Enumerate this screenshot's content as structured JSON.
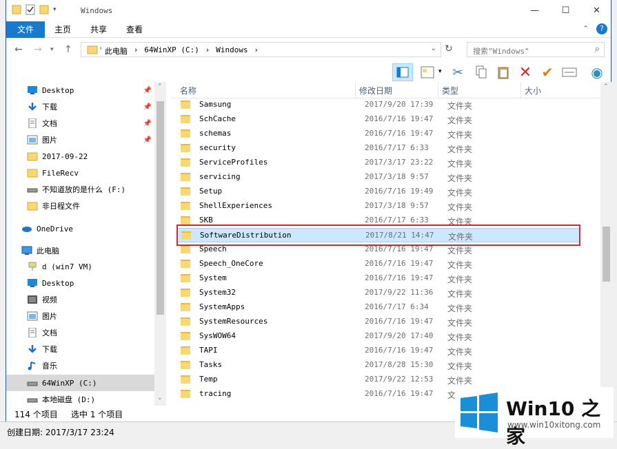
{
  "window": {
    "title": "Windows"
  },
  "ribbon": {
    "tabs": [
      "文件",
      "主页",
      "共享",
      "查看"
    ]
  },
  "address": {
    "crumbs": [
      "此电脑",
      "64WinXP (C:)",
      "Windows"
    ],
    "search_placeholder": "搜索\"Windows\""
  },
  "nav": {
    "items": [
      {
        "label": "Desktop",
        "icon": "desktop-icon",
        "pinned": true
      },
      {
        "label": "下载",
        "icon": "download-icon",
        "pinned": true
      },
      {
        "label": "文档",
        "icon": "document-icon",
        "pinned": true
      },
      {
        "label": "图片",
        "icon": "pictures-icon",
        "pinned": true
      },
      {
        "label": "2017-09-22",
        "icon": "folder-icon"
      },
      {
        "label": "FileRecv",
        "icon": "folder-icon"
      },
      {
        "label": "不知道放的是什么 (F:)",
        "icon": "drive-icon"
      },
      {
        "label": "非日程文件",
        "icon": "folder-icon"
      },
      {
        "label": "OneDrive",
        "icon": "onedrive-icon"
      },
      {
        "label": "此电脑",
        "icon": "computer-icon"
      },
      {
        "label": "d (win7 VM)",
        "icon": "network-drive-icon"
      },
      {
        "label": "Desktop",
        "icon": "desktop-icon"
      },
      {
        "label": "视频",
        "icon": "video-icon"
      },
      {
        "label": "图片",
        "icon": "pictures-icon"
      },
      {
        "label": "文档",
        "icon": "document-icon"
      },
      {
        "label": "下载",
        "icon": "download-icon"
      },
      {
        "label": "音乐",
        "icon": "music-icon"
      },
      {
        "label": "64WinXP (C:)",
        "icon": "drive-icon",
        "selected": true
      },
      {
        "label": "本地磁盘 (D:)",
        "icon": "drive-icon"
      }
    ]
  },
  "list": {
    "columns": [
      "名称",
      "修改日期",
      "类型",
      "大小"
    ],
    "rows": [
      {
        "name": "Samsung",
        "date": "2017/9/20 17:39",
        "type": "文件夹"
      },
      {
        "name": "SchCache",
        "date": "2016/7/16 19:47",
        "type": "文件夹"
      },
      {
        "name": "schemas",
        "date": "2016/7/16 19:47",
        "type": "文件夹"
      },
      {
        "name": "security",
        "date": "2016/7/17 6:33",
        "type": "文件夹"
      },
      {
        "name": "ServiceProfiles",
        "date": "2017/3/17 23:22",
        "type": "文件夹"
      },
      {
        "name": "servicing",
        "date": "2017/3/18 9:57",
        "type": "文件夹"
      },
      {
        "name": "Setup",
        "date": "2016/7/16 19:49",
        "type": "文件夹"
      },
      {
        "name": "ShellExperiences",
        "date": "2017/3/18 9:57",
        "type": "文件夹"
      },
      {
        "name": "SKB",
        "date": "2016/7/17 6:33",
        "type": "文件夹"
      },
      {
        "name": "SoftwareDistribution",
        "date": "2017/8/21 14:47",
        "type": "文件夹",
        "selected": true
      },
      {
        "name": "Speech",
        "date": "2016/7/16 19:47",
        "type": "文件夹"
      },
      {
        "name": "Speech_OneCore",
        "date": "2016/7/16 19:47",
        "type": "文件夹"
      },
      {
        "name": "System",
        "date": "2016/7/16 19:47",
        "type": "文件夹"
      },
      {
        "name": "System32",
        "date": "2017/9/22 11:36",
        "type": "文件夹"
      },
      {
        "name": "SystemApps",
        "date": "2016/7/17 6:34",
        "type": "文件夹"
      },
      {
        "name": "SystemResources",
        "date": "2016/7/16 19:47",
        "type": "文件夹"
      },
      {
        "name": "SysWOW64",
        "date": "2017/9/20 17:40",
        "type": "文件夹"
      },
      {
        "name": "TAPI",
        "date": "2016/7/16 19:47",
        "type": "文件夹"
      },
      {
        "name": "Tasks",
        "date": "2017/8/28 15:30",
        "type": "文件夹"
      },
      {
        "name": "Temp",
        "date": "2017/9/22 12:53",
        "type": "文件夹"
      },
      {
        "name": "tracing",
        "date": "2016/7/16 19:47",
        "type": "文件夹"
      }
    ]
  },
  "status": {
    "count": "114 个项目",
    "selected": "选中 1 个项目"
  },
  "bottom": {
    "text": "创建日期: 2017/3/17 23:24"
  },
  "watermark": {
    "brand": "Win10 之家",
    "url": "www.win10xitong.com"
  },
  "colors": {
    "accent": "#1979ca",
    "selection": "#cce8ff",
    "highlight_box": "#d9262c"
  }
}
